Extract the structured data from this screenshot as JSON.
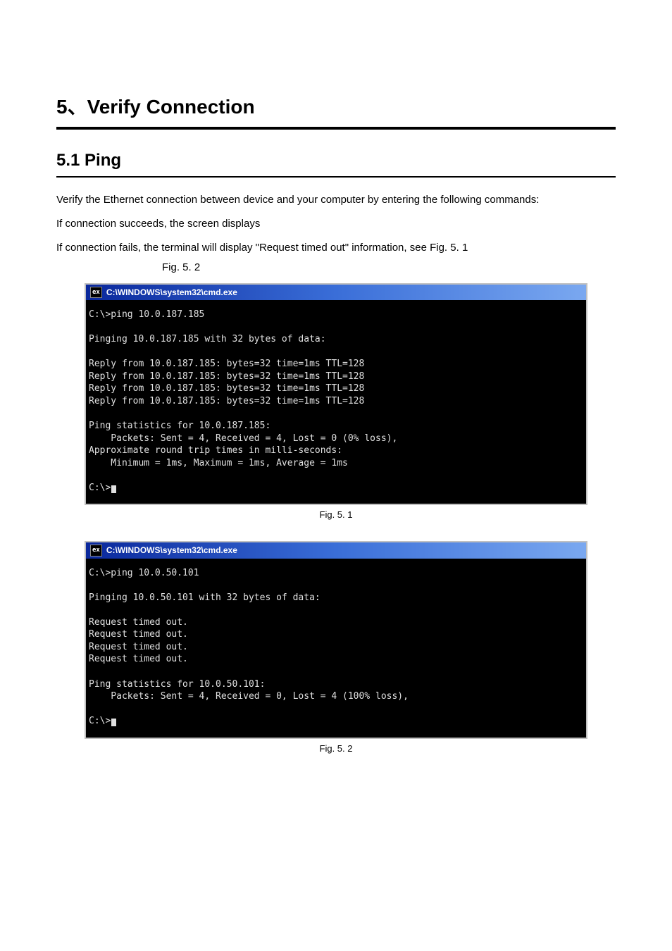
{
  "chapter": {
    "title": "5、Verify Connection"
  },
  "section": {
    "title": "5.1 Ping"
  },
  "para1": "Verify the Ethernet connection between device and your computer by entering the following commands:",
  "para2_pre": "If connection fails, the terminal will display ",
  "para2_quoted": "\"Request timed out\"",
  "para2_post": " information, see ",
  "para3": "If connection succeeds, the screen displays",
  "fig51_label": "Fig. 5. 1",
  "fig52_label": "Fig. 5. 2",
  "caption51": "Fig. 5. 1",
  "caption52": "Fig. 5. 2",
  "cmd1": {
    "icon_text": "ex",
    "title": "C:\\WINDOWS\\system32\\cmd.exe",
    "line1": "C:\\>ping 10.0.187.185",
    "line2": "Pinging 10.0.187.185 with 32 bytes of data:",
    "reply1": "Reply from 10.0.187.185: bytes=32 time=1ms TTL=128",
    "reply2": "Reply from 10.0.187.185: bytes=32 time=1ms TTL=128",
    "reply3": "Reply from 10.0.187.185: bytes=32 time=1ms TTL=128",
    "reply4": "Reply from 10.0.187.185: bytes=32 time=1ms TTL=128",
    "stats1": "Ping statistics for 10.0.187.185:",
    "stats2": "    Packets: Sent = 4, Received = 4, Lost = 0 (0% loss),",
    "stats3": "Approximate round trip times in milli-seconds:",
    "stats4": "    Minimum = 1ms, Maximum = 1ms, Average = 1ms",
    "prompt": "C:\\>"
  },
  "cmd2": {
    "icon_text": "ex",
    "title": "C:\\WINDOWS\\system32\\cmd.exe",
    "line1": "C:\\>ping 10.0.50.101",
    "line2": "Pinging 10.0.50.101 with 32 bytes of data:",
    "t1": "Request timed out.",
    "t2": "Request timed out.",
    "t3": "Request timed out.",
    "t4": "Request timed out.",
    "stats1": "Ping statistics for 10.0.50.101:",
    "stats2": "    Packets: Sent = 4, Received = 0, Lost = 4 (100% loss),",
    "prompt": "C:\\>"
  }
}
